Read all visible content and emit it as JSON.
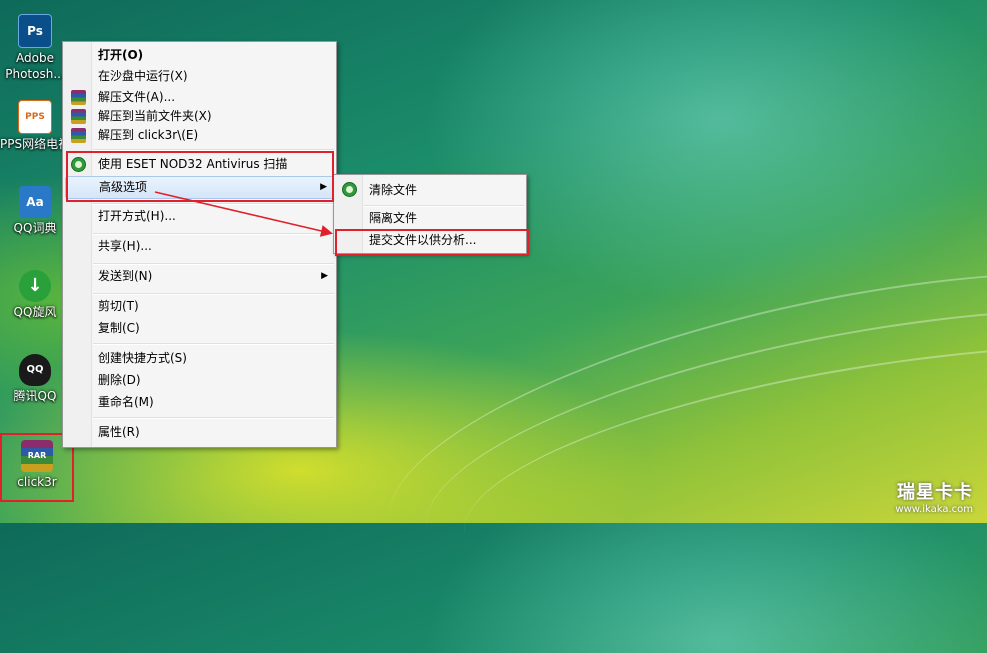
{
  "desktop": {
    "icons": [
      {
        "label": "Adobe Photosh...",
        "glyph": "Ps",
        "color": "#0a4f8a"
      },
      {
        "label": "PPS网络电视",
        "glyph": "PPS",
        "color": "#d86a1a"
      },
      {
        "label": "QQ词典",
        "glyph": "Aa",
        "color": "#2a78c8"
      },
      {
        "label": "QQ旋风",
        "glyph": "↓",
        "color": "#2aa03a"
      },
      {
        "label": "腾讯QQ",
        "glyph": "QQ",
        "color": "#1a1a1a"
      },
      {
        "label": "click3r",
        "glyph": "RAR",
        "color": "#6a2a70"
      }
    ]
  },
  "context_menu": {
    "items": [
      {
        "label": "打开(O)",
        "bold": true,
        "icon": ""
      },
      {
        "label": "在沙盘中运行(X)",
        "icon": ""
      },
      {
        "label": "解压文件(A)...",
        "icon": "winrar-icon"
      },
      {
        "label": "解压到当前文件夹(X)",
        "icon": "winrar-icon"
      },
      {
        "label": "解压到 click3r\\(E)",
        "icon": "winrar-icon"
      },
      {
        "label": "使用 ESET NOD32 Antivirus 扫描",
        "icon": "eset-icon"
      },
      {
        "label": "高级选项",
        "icon": "",
        "submenu": true
      },
      {
        "label": "打开方式(H)...",
        "icon": ""
      },
      {
        "label": "共享(H)...",
        "icon": ""
      },
      {
        "label": "发送到(N)",
        "icon": "",
        "submenu": true
      },
      {
        "label": "剪切(T)",
        "icon": ""
      },
      {
        "label": "复制(C)",
        "icon": ""
      },
      {
        "label": "创建快捷方式(S)",
        "icon": ""
      },
      {
        "label": "删除(D)",
        "icon": ""
      },
      {
        "label": "重命名(M)",
        "icon": ""
      },
      {
        "label": "属性(R)",
        "icon": ""
      }
    ],
    "submenu_arrow": "▶"
  },
  "submenu": {
    "items": [
      {
        "label": "清除文件",
        "icon": "eset-icon"
      },
      {
        "label": "隔离文件",
        "icon": ""
      },
      {
        "label": "提交文件以供分析...",
        "icon": ""
      }
    ]
  },
  "annotation": {
    "color": "#e0202a"
  },
  "watermark": {
    "title": "瑞星卡卡",
    "url": "www.ikaka.com"
  }
}
